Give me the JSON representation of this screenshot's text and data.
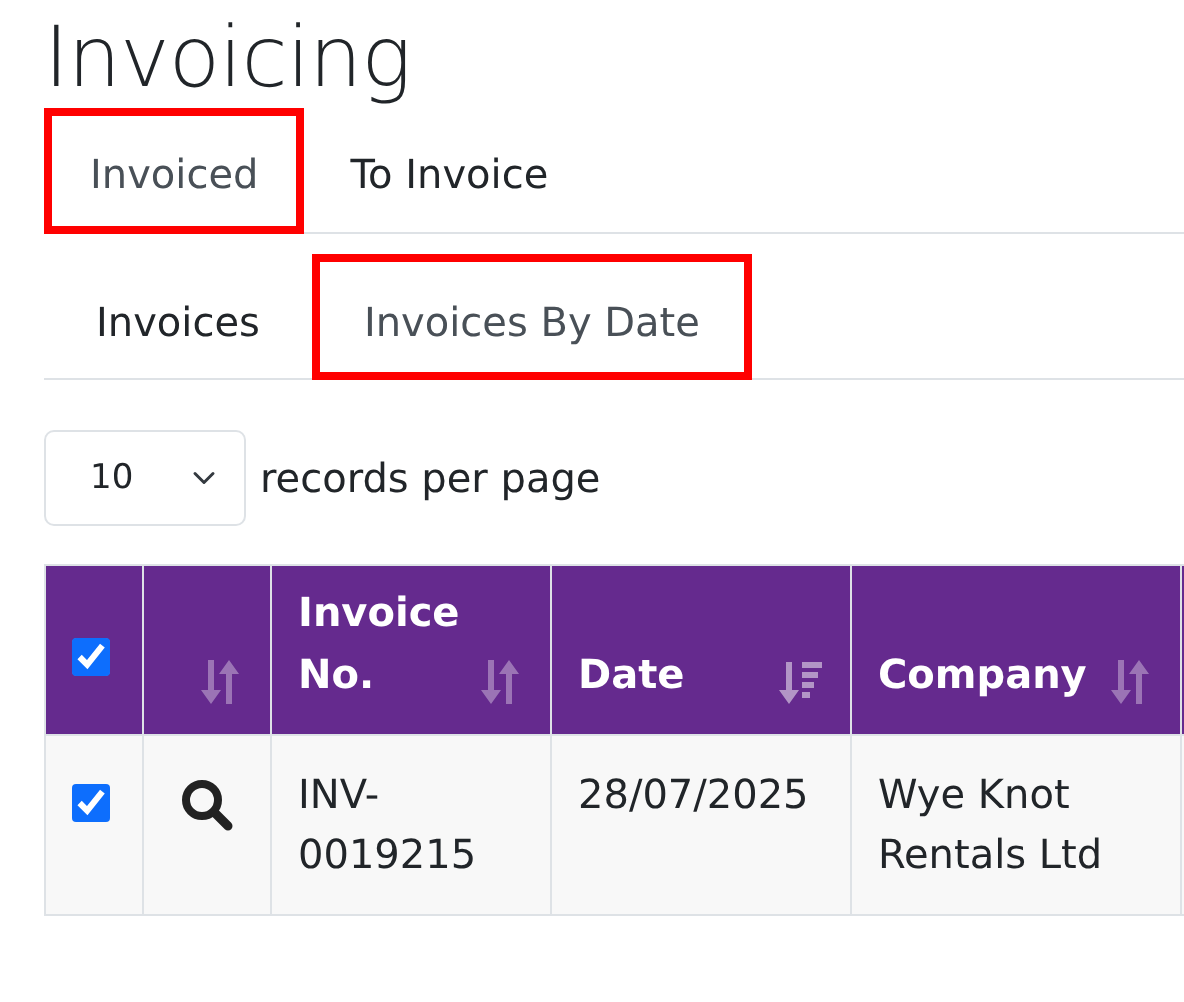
{
  "page_title": "Invoicing",
  "tabs": [
    {
      "label": "Invoiced",
      "selected": true,
      "highlighted": true
    },
    {
      "label": "To Invoice",
      "selected": false,
      "highlighted": false
    }
  ],
  "subtabs": [
    {
      "label": "Invoices",
      "selected": false,
      "highlighted": false
    },
    {
      "label": "Invoices By Date",
      "selected": true,
      "highlighted": true
    }
  ],
  "page_size": {
    "value": "10",
    "label": "records per page"
  },
  "table": {
    "columns": [
      {
        "kind": "checkbox",
        "checked": true
      },
      {
        "kind": "action",
        "sorted": false
      },
      {
        "kind": "text",
        "label": "Invoice No.",
        "sorted": false
      },
      {
        "kind": "text",
        "label": "Date",
        "sorted": true
      },
      {
        "kind": "text",
        "label": "Company",
        "sorted": false
      }
    ],
    "rows": [
      {
        "checked": true,
        "invoice_no": "INV-0019215",
        "date": "28/07/2025",
        "company": "Wye Knot Rentals Ltd"
      }
    ]
  }
}
